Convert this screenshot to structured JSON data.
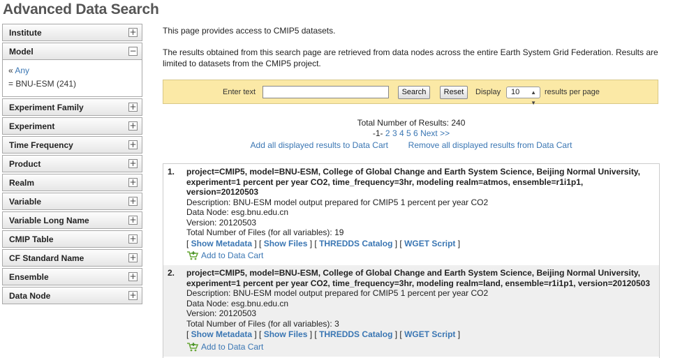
{
  "page": {
    "title": "Advanced Data Search"
  },
  "sidebar": {
    "facets": [
      {
        "label": "Institute",
        "toggle": "+"
      },
      {
        "label": "Model",
        "toggle": "−",
        "any_prefix": "« ",
        "any_label": "Any",
        "selected_prefix": "= ",
        "selected": "BNU-ESM (241)"
      },
      {
        "label": "Experiment Family",
        "toggle": "+"
      },
      {
        "label": "Experiment",
        "toggle": "+"
      },
      {
        "label": "Time Frequency",
        "toggle": "+"
      },
      {
        "label": "Product",
        "toggle": "+"
      },
      {
        "label": "Realm",
        "toggle": "+"
      },
      {
        "label": "Variable",
        "toggle": "+"
      },
      {
        "label": "Variable Long Name",
        "toggle": "+"
      },
      {
        "label": "CMIP Table",
        "toggle": "+"
      },
      {
        "label": "CF Standard Name",
        "toggle": "+"
      },
      {
        "label": "Ensemble",
        "toggle": "+"
      },
      {
        "label": "Data Node",
        "toggle": "+"
      }
    ]
  },
  "intro": {
    "line1": "This page provides access to CMIP5 datasets.",
    "line2": "The results obtained from this search page are retrieved from data nodes across the entire Earth System Grid Federation. Results are limited to datasets from the CMIP5 project."
  },
  "search": {
    "enter_text_label": "Enter text",
    "input_value": "",
    "search_button": "Search",
    "reset_button": "Reset",
    "display_label": "Display",
    "display_value": "10",
    "per_page_label": "results per page"
  },
  "summary": {
    "total_label": "Total Number of Results: 240",
    "current_page": "-1-",
    "pages": [
      "2",
      "3",
      "4",
      "5",
      "6"
    ],
    "next_label": "Next >>",
    "add_all": "Add all displayed results to Data Cart",
    "remove_all": "Remove all displayed results from Data Cart"
  },
  "results": [
    {
      "num": "1.",
      "head": "project=CMIP5, model=BNU-ESM, College of Global Change and Earth System Science, Beijing Normal University, experiment=1 percent per year CO2, time_frequency=3hr, modeling realm=atmos, ensemble=r1i1p1, version=20120503",
      "description": "Description: BNU-ESM model output prepared for CMIP5 1 percent per year CO2",
      "data_node": "Data Node: esg.bnu.edu.cn",
      "version": "Version: 20120503",
      "files": "Total Number of Files (for all variables): 19",
      "show_metadata": "Show Metadata",
      "show_files": "Show Files",
      "thredds": "THREDDS Catalog",
      "wget": "WGET Script",
      "add_cart": "Add to Data Cart"
    },
    {
      "num": "2.",
      "head": "project=CMIP5, model=BNU-ESM, College of Global Change and Earth System Science, Beijing Normal University, experiment=1 percent per year CO2, time_frequency=3hr, modeling realm=land, ensemble=r1i1p1, version=20120503",
      "description": "Description: BNU-ESM model output prepared for CMIP5 1 percent per year CO2",
      "data_node": "Data Node: esg.bnu.edu.cn",
      "version": "Version: 20120503",
      "files": "Total Number of Files (for all variables): 3",
      "show_metadata": "Show Metadata",
      "show_files": "Show Files",
      "thredds": "THREDDS Catalog",
      "wget": "WGET Script",
      "add_cart": "Add to Data Cart"
    }
  ],
  "colors": {
    "link": "#3a76b3",
    "search_bar_bg": "#fbe9a6",
    "alt_row_bg": "#efefef",
    "cart_icon": "#6aa83a"
  }
}
